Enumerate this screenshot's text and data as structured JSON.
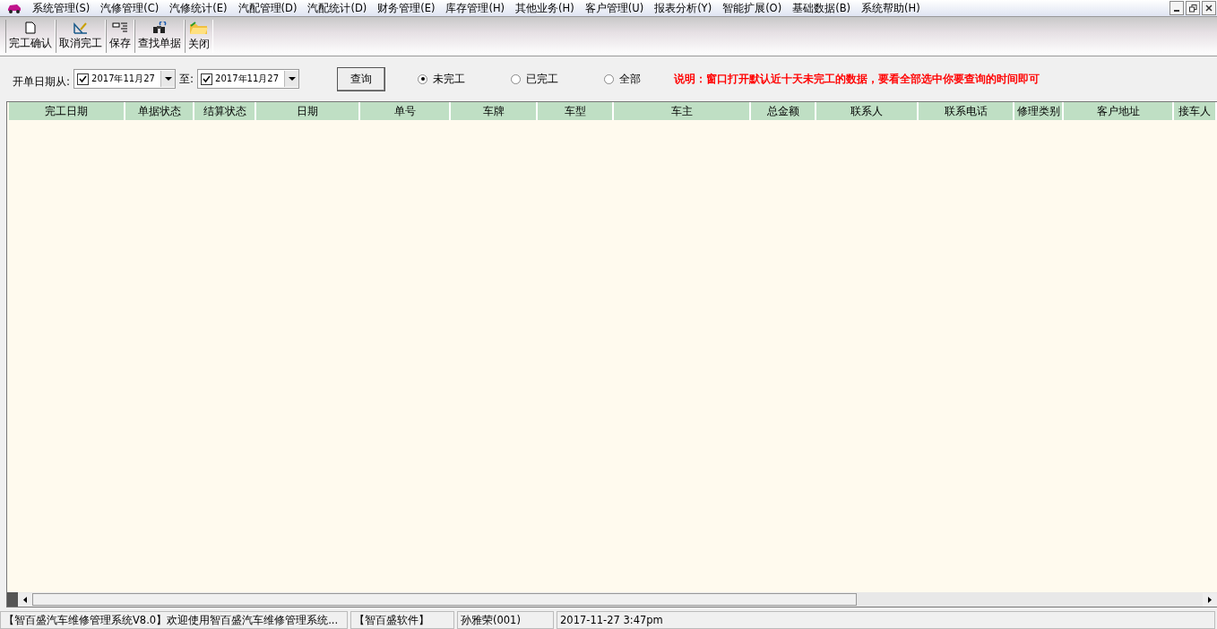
{
  "menu": [
    "系统管理(S)",
    "汽修管理(C)",
    "汽修统计(E)",
    "汽配管理(D)",
    "汽配统计(D)",
    "财务管理(E)",
    "库存管理(H)",
    "其他业务(H)",
    "客户管理(U)",
    "报表分析(Y)",
    "智能扩展(O)",
    "基础数据(B)",
    "系统帮助(H)"
  ],
  "toolbar": [
    {
      "label": "完工确认",
      "kind": "doc"
    },
    {
      "label": "取消完工",
      "kind": "ruler"
    },
    {
      "label": "保存",
      "kind": "save"
    },
    {
      "label": "查找单据",
      "kind": "find"
    },
    {
      "label": "关闭",
      "kind": "folder"
    }
  ],
  "filter": {
    "from_label": "开单日期从:",
    "from": {
      "value": "2017年11月27",
      "checked": true
    },
    "to_label": "至:",
    "to": {
      "value": "2017年11月27",
      "checked": true
    },
    "query_button": "查询",
    "options": [
      {
        "label": "未完工",
        "selected": true
      },
      {
        "label": "已完工",
        "selected": false
      },
      {
        "label": "全部",
        "selected": false
      }
    ],
    "note": "说明：窗口打开默认近十天未完工的数据，要看全部选中你要查询的时间即可"
  },
  "table": {
    "columns": [
      "完工日期",
      "单据状态",
      "结算状态",
      "日期",
      "单号",
      "车牌",
      "车型",
      "车主",
      "总金额",
      "联系人",
      "联系电话",
      "修理类别",
      "客户地址",
      "接车人"
    ]
  },
  "status_bar": [
    "【智百盛汽车维修管理系统V8.0】欢迎使用智百盛汽车维修管理系统...",
    "【智百盛软件】",
    "孙雅荣(001)",
    "2017-11-27 3:47pm"
  ]
}
